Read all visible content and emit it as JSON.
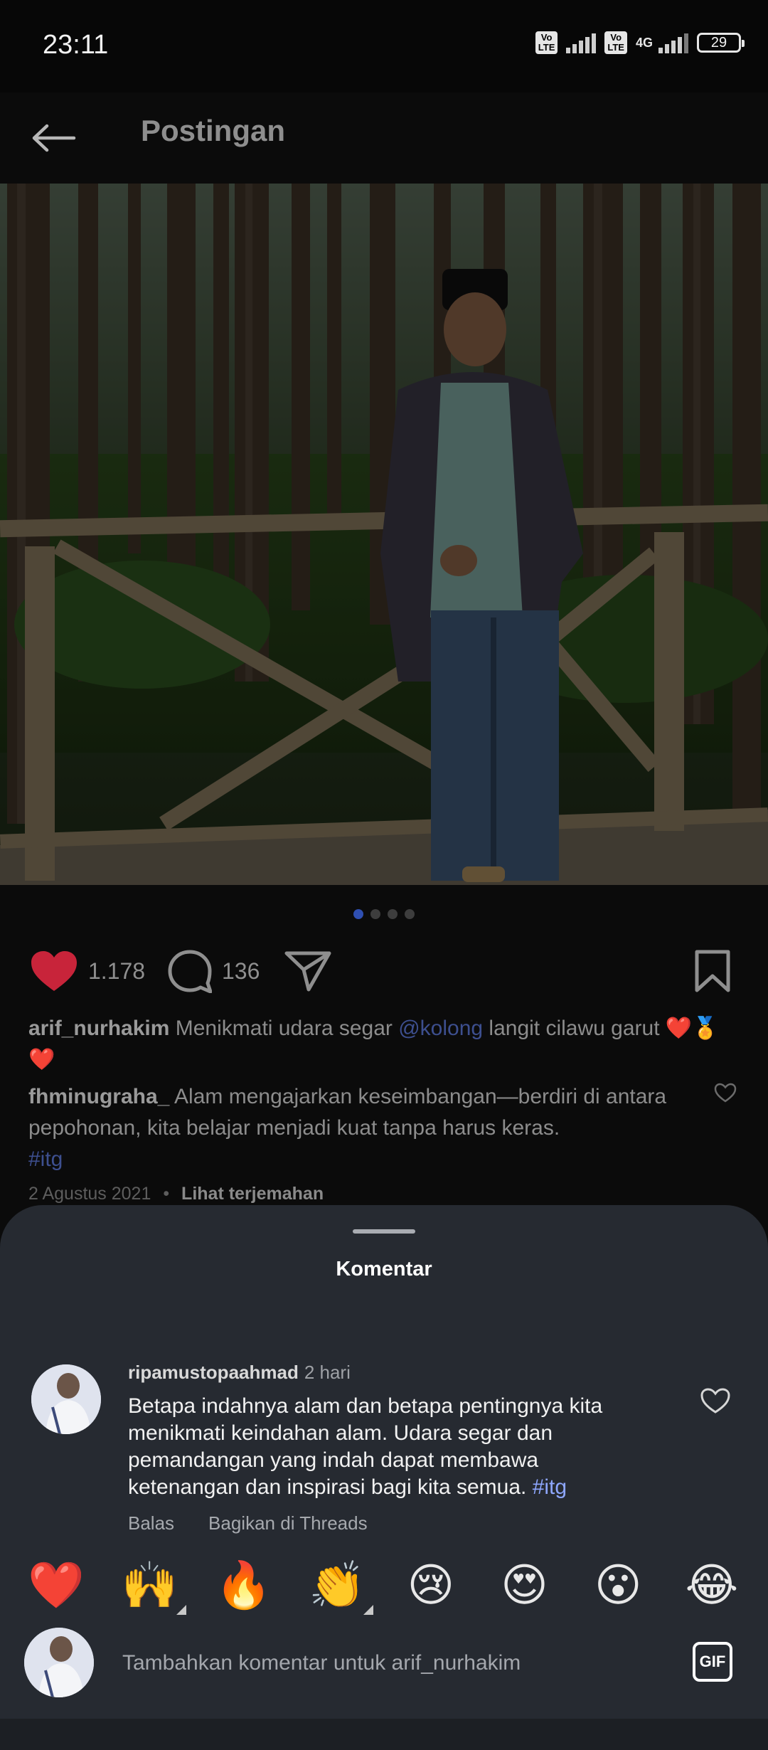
{
  "status_bar": {
    "time": "23:11",
    "volte_label_1": "Vo\nLTE",
    "volte_label_2": "Vo\nLTE",
    "network_type": "4G",
    "battery_level": "29"
  },
  "header": {
    "back_icon": "arrow-left-icon",
    "title": "Postingan"
  },
  "carousel": {
    "total_images": 4,
    "active_index": 0
  },
  "actions": {
    "like_count": "1.178",
    "comment_count": "136",
    "like_icon": "heart-filled-icon",
    "comment_icon": "speech-bubble-icon",
    "share_icon": "paper-plane-icon",
    "save_icon": "bookmark-icon",
    "like_color": "#c8243a"
  },
  "caption": {
    "username": "arif_nurhakim",
    "text_before": " Menikmati udara segar ",
    "mention": "@kolong",
    "text_after": " langit cilawu garut ❤️🏅",
    "line2": "❤️"
  },
  "top_comment": {
    "username": "fhminugraha_",
    "text": " Alam mengajarkan keseimbangan—berdiri di antara pepohonan, kita belajar menjadi kuat tanpa harus keras.",
    "hashtag": "#itg"
  },
  "post_meta": {
    "date": "2 Agustus 2021",
    "separator": "•",
    "translate_label": "Lihat terjemahan"
  },
  "comments_sheet": {
    "title": "Komentar",
    "comments": [
      {
        "author": "ripamustopaahmad",
        "time": "2 hari",
        "text": "Betapa indahnya alam dan betapa pentingnya kita menikmati keindahan alam. Udara segar dan pemandangan yang indah dapat membawa ketenangan dan inspirasi bagi kita semua. ",
        "hashtag": "#itg",
        "reply_label": "Balas",
        "share_threads_label": "Bagikan di Threads"
      }
    ],
    "emoji_reactions": [
      "❤️",
      "🙌",
      "🔥",
      "👏",
      "😢",
      "😍",
      "😮",
      "😂"
    ],
    "composer": {
      "placeholder": "Tambahkan komentar untuk arif_nurhakim",
      "gif_label": "GIF"
    }
  },
  "colors": {
    "background": "#0b0b0b",
    "sheet_background": "#262a31",
    "link_blue": "#3d4f8f",
    "hashtag_blue_sheet": "#8ea7ff"
  }
}
